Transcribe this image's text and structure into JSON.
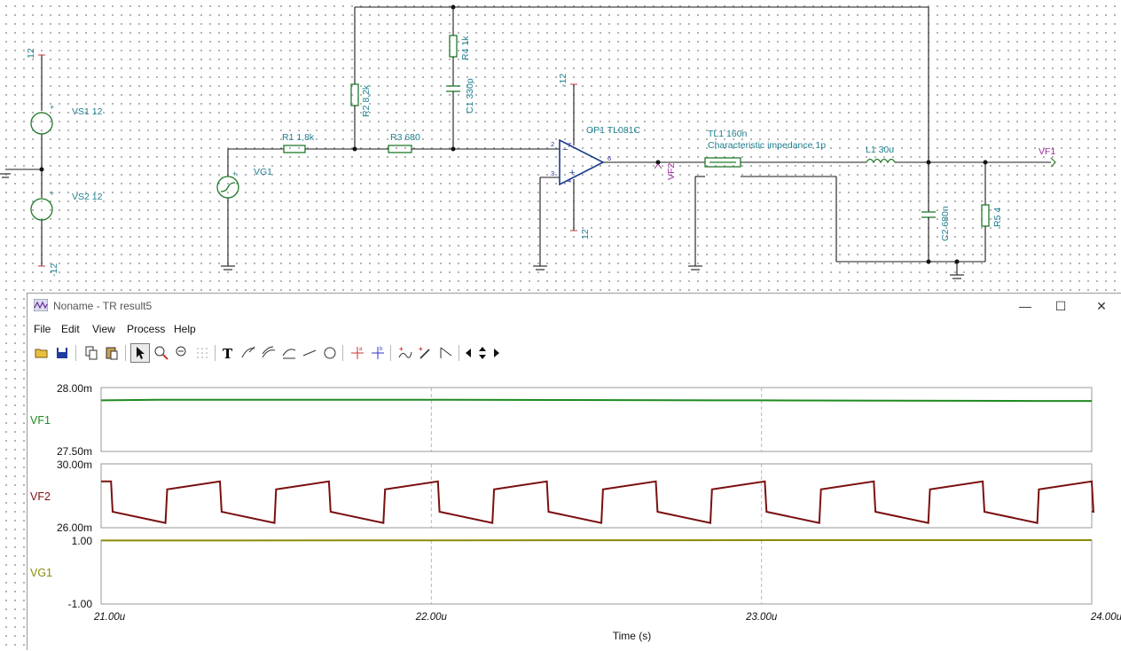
{
  "schematic": {
    "labels": {
      "v12_top": "12",
      "vs1": "VS1 12",
      "vs2": "VS2 12",
      "vm12_bottom": "-12",
      "vg1": "VG1",
      "r1": "R1 1,8k",
      "r2": "R2 8,2k",
      "r3": "R3 680",
      "r4": "R4 1k",
      "c1": "C1 330p",
      "op_vm12": "-12",
      "op_v12": "12",
      "op1": "OP1 TL081C",
      "vf2_probe": "VF2",
      "tl1": "TL1 160n",
      "tl1_imp": "Characteristic impedance 1p",
      "l1": "L1 30u",
      "c2": "C2 680n",
      "r5": "R5 4",
      "vf1_probe": "VF1",
      "pin2": "2",
      "pin3": "3",
      "pin6": "6",
      "pin4": "4",
      "pin7": "7"
    }
  },
  "window": {
    "title": "Noname - TR result5",
    "controls": {
      "minimize": "—",
      "maximize": "☐",
      "close": "✕"
    },
    "menu": [
      "File",
      "Edit",
      "View",
      "Process",
      "Help"
    ],
    "toolbar_icons": [
      "open-icon",
      "save-icon",
      "copy-icon",
      "paste-icon",
      "pointer-icon",
      "zoom-in-icon",
      "zoom-100-icon",
      "grid-icon",
      "text-icon",
      "curve-tool-icon",
      "curve-tool-2-icon",
      "curve-tool-3-icon",
      "line-icon",
      "circle-icon",
      "cursor-a-icon",
      "cursor-b-icon",
      "signal-icon",
      "probe-icon",
      "ramp-icon",
      "left-arrow-icon",
      "up-down-arrow-icon",
      "right-arrow-icon"
    ]
  },
  "chart_data": {
    "type": "line",
    "xlabel": "Time (s)",
    "x_ticks": [
      "21.00u",
      "22.00u",
      "23.00u",
      "24.00u"
    ],
    "xlim": [
      21.0,
      24.0
    ],
    "x_unit": "us",
    "grid": "vertical dashed",
    "panels": [
      {
        "name": "VF1",
        "color": "#1e8a1e",
        "ylim": [
          27.5,
          28.0
        ],
        "y_ticks": [
          "28.00m",
          "27.50m"
        ],
        "x": [
          21.0,
          21.17,
          22.0,
          22.87,
          23.0,
          23.83,
          24.0
        ],
        "y": [
          27.9,
          27.905,
          27.905,
          27.9,
          27.9,
          27.895,
          27.895
        ]
      },
      {
        "name": "VF2",
        "color": "#7a1010",
        "ylim": [
          26.0,
          30.0
        ],
        "y_ticks": [
          "30.00m",
          "26.00m"
        ],
        "period_us": 0.32,
        "first_drop_us": 21.03,
        "high_start": 28.4,
        "high_end": 28.9,
        "low_start": 27.0,
        "low_end": 26.3,
        "rise_time_us": 0.005,
        "fall_time_us": 0.005,
        "high_duration_us": 0.16
      },
      {
        "name": "VG1",
        "color": "#8a8a0a",
        "ylim": [
          -1.0,
          1.0
        ],
        "y_ticks": [
          "1.00",
          "-1.00"
        ],
        "x": [
          21.0,
          23.35,
          24.0
        ],
        "y": [
          0.99,
          1.0,
          1.0
        ]
      }
    ]
  }
}
